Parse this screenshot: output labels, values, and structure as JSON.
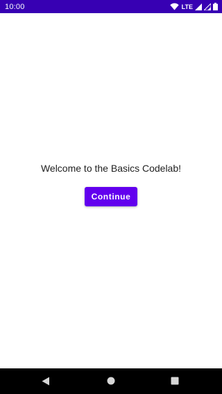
{
  "status_bar": {
    "time": "10:00",
    "network_label": "LTE",
    "icons": [
      "wifi-icon",
      "lte-signal-icon",
      "signal-icon",
      "battery-icon"
    ],
    "background_color": "#3700b3"
  },
  "main": {
    "welcome_text": "Welcome to the Basics Codelab!",
    "continue_label": "Continue",
    "button_color": "#6200ee"
  },
  "nav_bar": {
    "icons": [
      "back-icon",
      "home-icon",
      "recents-icon"
    ]
  }
}
